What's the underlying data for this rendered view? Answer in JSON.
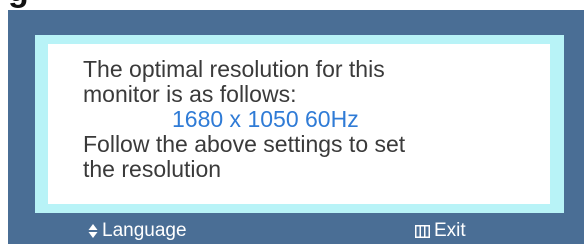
{
  "top_fragment": "g",
  "osd": {
    "message_lines": [
      "The optimal resolution for this",
      "monitor is as follows:",
      "1680 x 1050 60Hz",
      "Follow the above settings to set",
      "the resolution"
    ]
  },
  "footer": {
    "language": {
      "label": "Language",
      "icon": "up-down-arrows-icon"
    },
    "exit": {
      "label": "Exit",
      "icon": "menu-button-icon"
    }
  },
  "colors": {
    "frame": "#4a6e95",
    "border": "#b8f3f7",
    "panel": "#ffffff",
    "text": "#3a3a3a",
    "accent": "#2f7bd6"
  }
}
